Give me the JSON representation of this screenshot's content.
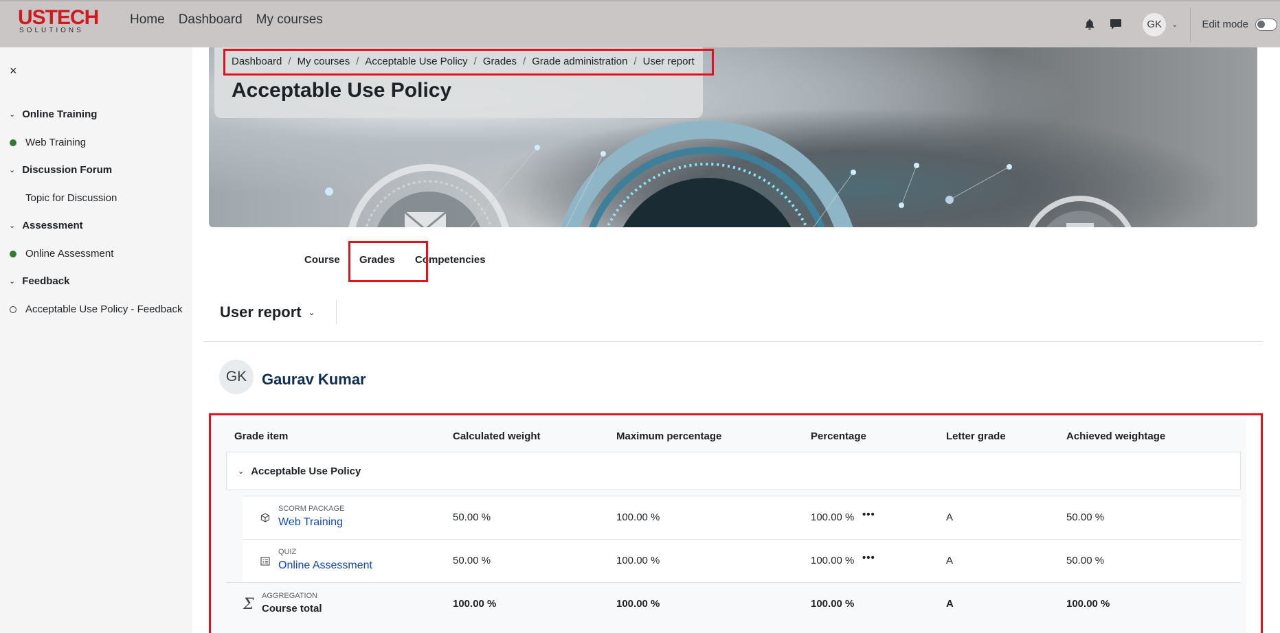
{
  "brand": {
    "logo_top": "USTECH",
    "logo_sub": "SOLUTIONS"
  },
  "nav": {
    "items": [
      "Home",
      "Dashboard",
      "My courses"
    ]
  },
  "user_menu": {
    "initials": "GK",
    "edit_mode_label": "Edit mode"
  },
  "sidebar": {
    "close": "×",
    "sections": [
      {
        "title": "Online Training",
        "activities": [
          {
            "label": "Web Training",
            "status": "done"
          }
        ]
      },
      {
        "title": "Discussion Forum",
        "activities": [
          {
            "label": "Topic for Discussion",
            "status": "none"
          }
        ]
      },
      {
        "title": "Assessment",
        "activities": [
          {
            "label": "Online Assessment",
            "status": "done"
          }
        ]
      },
      {
        "title": "Feedback",
        "activities": [
          {
            "label": "Acceptable Use Policy - Feedback",
            "status": "empty"
          }
        ]
      }
    ]
  },
  "breadcrumb": [
    "Dashboard",
    "My courses",
    "Acceptable Use Policy",
    "Grades",
    "Grade administration",
    "User report"
  ],
  "page_title": "Acceptable Use Policy",
  "secondary_nav": [
    "Course",
    "Grades",
    "Competencies"
  ],
  "report_selector": "User report",
  "user": {
    "initials": "GK",
    "name": "Gaurav Kumar"
  },
  "table": {
    "headers": [
      "Grade item",
      "Calculated weight",
      "Maximum percentage",
      "Percentage",
      "Letter grade",
      "Achieved weightage"
    ],
    "category": "Acceptable Use Policy",
    "items": [
      {
        "type": "SCORM PACKAGE",
        "name": "Web Training",
        "weight": "50.00 %",
        "max_pct": "100.00 %",
        "pct": "100.00 %",
        "letter": "A",
        "achieved": "50.00 %"
      },
      {
        "type": "QUIZ",
        "name": "Online Assessment",
        "weight": "50.00 %",
        "max_pct": "100.00 %",
        "pct": "100.00 %",
        "letter": "A",
        "achieved": "50.00 %"
      }
    ],
    "total": {
      "type": "AGGREGATION",
      "name": "Course total",
      "weight": "100.00 %",
      "max_pct": "100.00 %",
      "pct": "100.00 %",
      "letter": "A",
      "achieved": "100.00 %"
    }
  },
  "colors": {
    "highlight": "#e4111c",
    "topbar": "#c9c6c5",
    "link": "#0f47ad",
    "complete": "#357a32"
  }
}
